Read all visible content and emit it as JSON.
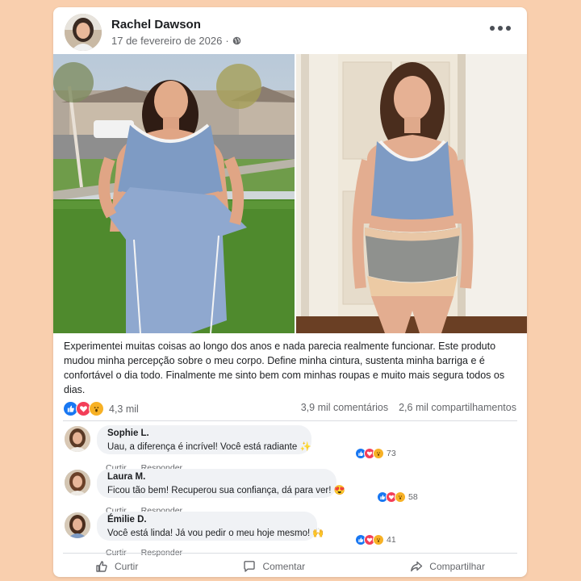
{
  "post": {
    "author": "Rachel Dawson",
    "date": "17 de fevereiro de 2026",
    "privacy_icon": "globe-icon",
    "caption": "Experimentei muitas coisas ao longo dos anos e nada parecia realmente funcionar. Este produto mudou minha percepção sobre o meu corpo. Define minha cintura, sustenta minha barriga e é confortável o dia todo. Finalmente me sinto bem com minhas roupas e muito mais segura todos os dias."
  },
  "stats": {
    "reactions_count": "4,3 mil",
    "comments": "3,9 mil comentários",
    "shares": "2,6 mil compartilhamentos"
  },
  "comments": [
    {
      "name": "Sophie L.",
      "text": "Uau, a diferença é incrível! Você está radiante ✨",
      "reactions": "73",
      "like_label": "Curtir",
      "reply_label": "Responder"
    },
    {
      "name": "Laura M.",
      "text": "Ficou tão bem! Recuperou sua confiança, dá para ver! 😍",
      "reactions": "58",
      "like_label": "Curtir",
      "reply_label": "Responder"
    },
    {
      "name": "Émilie D.",
      "text": "Você está linda! Já vou pedir o meu hoje mesmo! 🙌",
      "reactions": "41",
      "like_label": "Curtir",
      "reply_label": "Responder"
    }
  ],
  "actions": {
    "like": "Curtir",
    "comment": "Comentar",
    "share": "Compartilhar"
  },
  "colors": {
    "background": "#f9cfae",
    "like_blue": "#1877f2",
    "love_red": "#f33e58",
    "wow_yellow": "#f7b125"
  }
}
